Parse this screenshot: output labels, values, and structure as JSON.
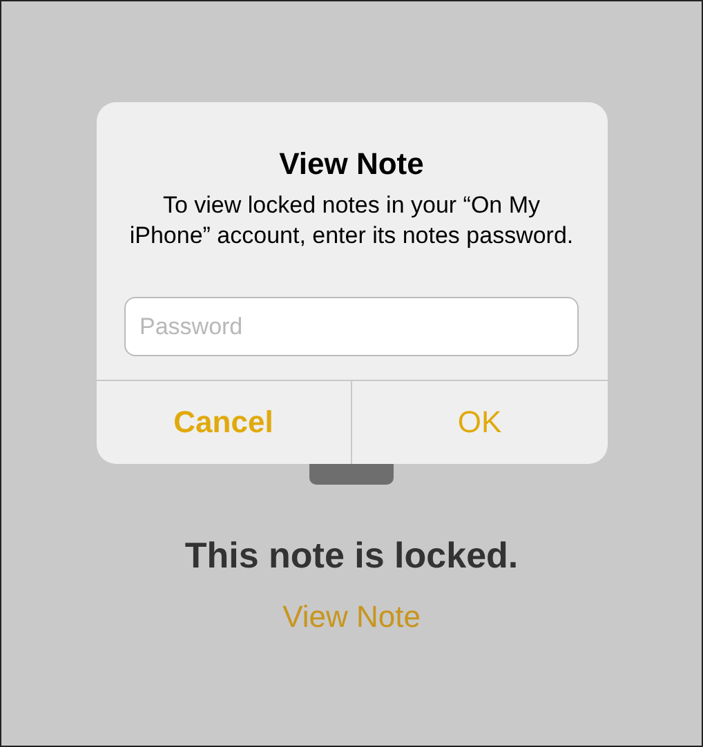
{
  "dialog": {
    "title": "View Note",
    "message": "To view locked notes in your “On My iPhone” account, enter its notes password.",
    "password": {
      "placeholder": "Password"
    },
    "buttons": [
      {
        "label": "Cancel",
        "kind": "cancel"
      },
      {
        "label": "OK",
        "kind": "default"
      }
    ]
  },
  "locked_screen": {
    "message": "This note is locked.",
    "link": "View Note"
  }
}
